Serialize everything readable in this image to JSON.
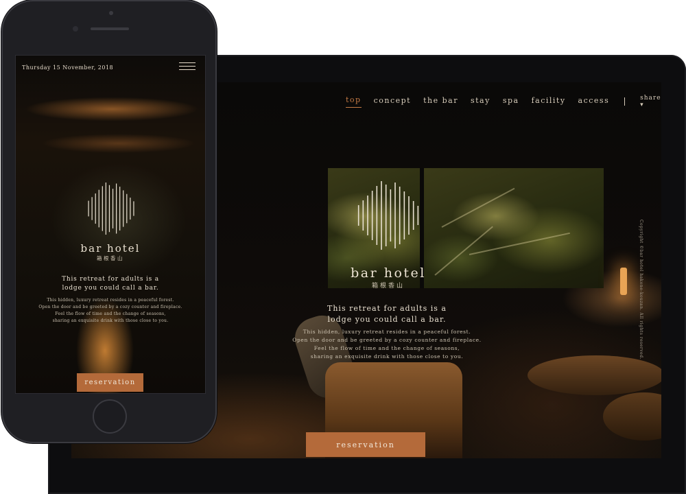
{
  "laptop": {
    "nav": {
      "items": [
        {
          "label": "top",
          "active": true
        },
        {
          "label": "concept"
        },
        {
          "label": "the bar"
        },
        {
          "label": "stay"
        },
        {
          "label": "spa"
        },
        {
          "label": "facility"
        },
        {
          "label": "access"
        }
      ],
      "share_label": "share",
      "share_icon": "chevron-down-icon",
      "menu_icon": "hamburger-menu-icon"
    },
    "brand": "bar hotel",
    "brand_sub": "箱根香山",
    "tagline": [
      "This retreat for adults is a",
      "lodge you could call a bar."
    ],
    "description": [
      "This hidden, luxury retreat resides in a peaceful forest.",
      "Open the door and be greeted by a cozy counter and fireplace.",
      "Feel the flow of time and the change of seasons,",
      "sharing an exquisite drink with those close to you."
    ],
    "reservation_label": "reservation",
    "copyright": "Copyright ©bar hotel hakone-kouzan. All rights reserved."
  },
  "phone": {
    "date": "Thursday 15 November, 2018",
    "menu_icon": "hamburger-menu-icon",
    "brand": "bar hotel",
    "brand_sub": "箱根香山",
    "tagline": [
      "This retreat for adults is a",
      "lodge you could call a bar."
    ],
    "description": [
      "This hidden, luxury retreat resides in a peaceful forest.",
      "Open the door and be greeted by a cozy counter and fireplace.",
      "Feel the flow of time and the change of seasons,",
      "sharing an exquisite drink with those close to you."
    ],
    "reservation_label": "reservation"
  },
  "colors": {
    "accent": "#b46a3a",
    "active_nav": "#c47a45",
    "text_light": "#ece3d3",
    "background": "#0d0b09"
  }
}
